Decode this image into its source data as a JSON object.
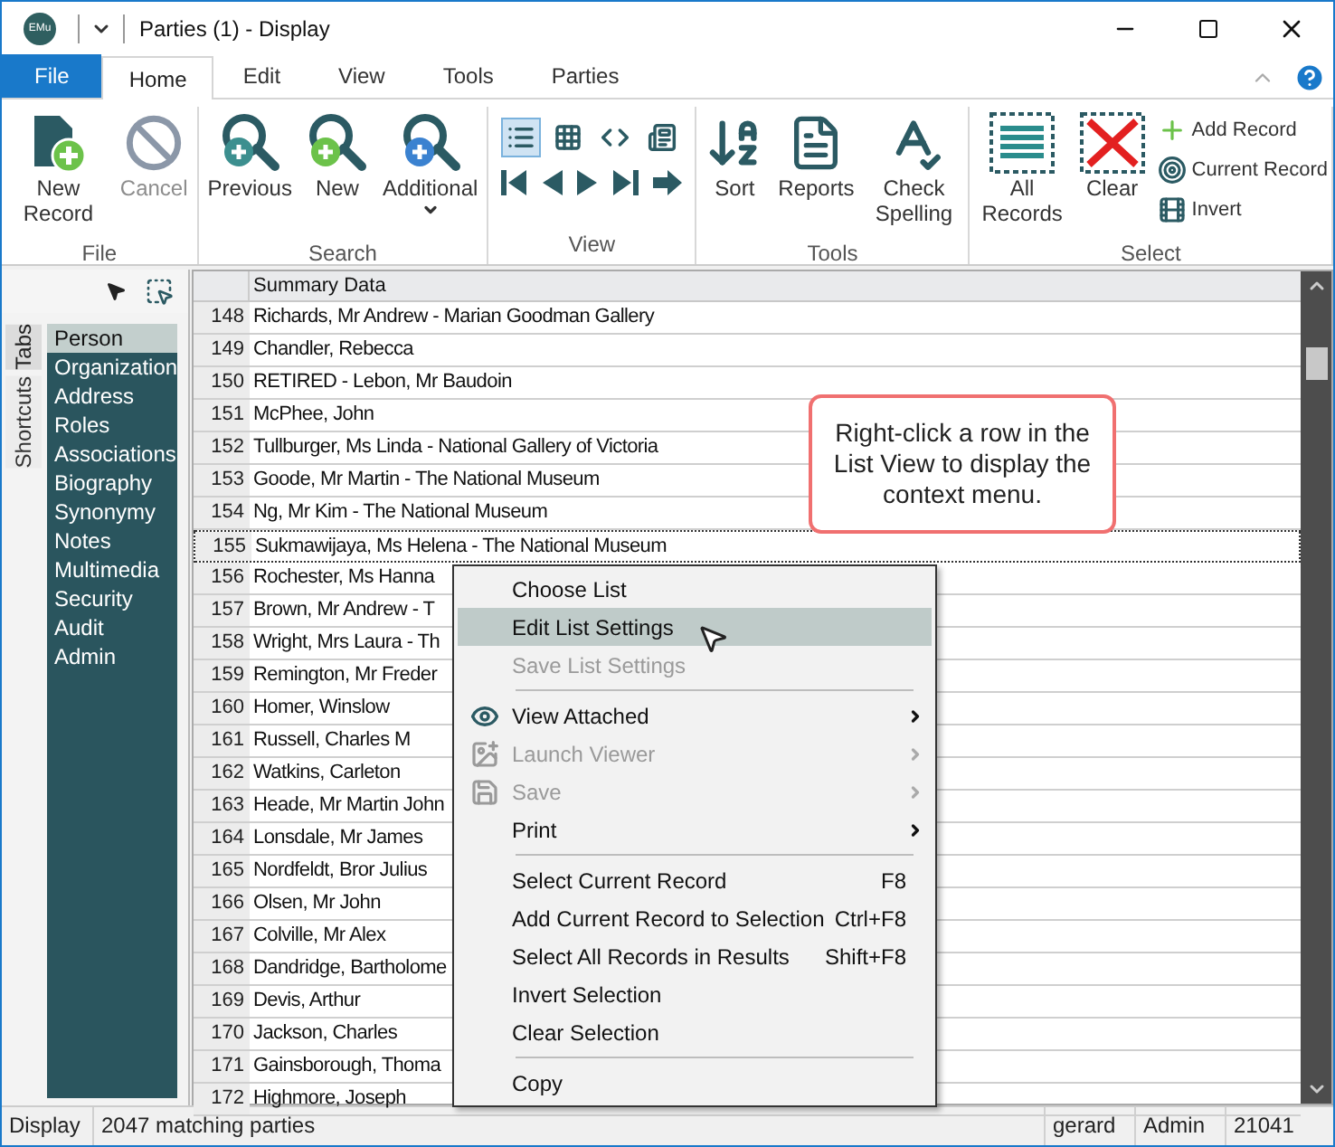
{
  "title_bar": {
    "logo": "EMu",
    "title": "Parties (1) - Display"
  },
  "ribbon_tabs": [
    {
      "label": "File",
      "kind": "file",
      "selected": false
    },
    {
      "label": "Home",
      "kind": "tab",
      "selected": true
    },
    {
      "label": "Edit",
      "kind": "tab",
      "selected": false
    },
    {
      "label": "View",
      "kind": "tab",
      "selected": false
    },
    {
      "label": "Tools",
      "kind": "tab",
      "selected": false
    },
    {
      "label": "Parties",
      "kind": "tab",
      "selected": false
    }
  ],
  "ribbon_groups": [
    {
      "title": "File",
      "kind": "large",
      "buttons": [
        {
          "label": "New Record",
          "disabled": false,
          "dropdown": false
        },
        {
          "label": "Cancel",
          "disabled": true,
          "dropdown": false
        }
      ]
    },
    {
      "title": "Search",
      "kind": "large",
      "buttons": [
        {
          "label": "Previous",
          "disabled": false,
          "dropdown": false
        },
        {
          "label": "New",
          "disabled": false,
          "dropdown": false
        },
        {
          "label": "Additional",
          "disabled": false,
          "dropdown": true
        }
      ]
    },
    {
      "title": "View",
      "kind": "view",
      "view_modes": [
        {
          "selected": true
        },
        {
          "selected": false
        },
        {
          "selected": false
        },
        {
          "selected": false
        }
      ]
    },
    {
      "title": "Tools",
      "kind": "large",
      "buttons": [
        {
          "label": "Sort",
          "disabled": false,
          "dropdown": false
        },
        {
          "label": "Reports",
          "disabled": false,
          "dropdown": false
        },
        {
          "label": "Check Spelling",
          "disabled": false,
          "dropdown": false
        }
      ]
    },
    {
      "title": "Select",
      "kind": "select",
      "buttons": [
        {
          "label": "All Records",
          "disabled": false,
          "dropdown": false
        },
        {
          "label": "Clear",
          "disabled": false,
          "dropdown": false
        }
      ],
      "small_buttons": [
        "Add Record",
        "Current Record",
        "Invert"
      ]
    }
  ],
  "left_panel": {
    "vertical_tabs": [
      {
        "label": "Tabs",
        "selected": true
      },
      {
        "label": "Shortcuts",
        "selected": false
      }
    ],
    "tab_items": [
      {
        "label": "Person",
        "selected": true
      },
      {
        "label": "Organization",
        "selected": false
      },
      {
        "label": "Address",
        "selected": false
      },
      {
        "label": "Roles",
        "selected": false
      },
      {
        "label": "Associations",
        "selected": false
      },
      {
        "label": "Biography",
        "selected": false
      },
      {
        "label": "Synonymy",
        "selected": false
      },
      {
        "label": "Notes",
        "selected": false
      },
      {
        "label": "Multimedia",
        "selected": false
      },
      {
        "label": "Security",
        "selected": false
      },
      {
        "label": "Audit",
        "selected": false
      },
      {
        "label": "Admin",
        "selected": false
      }
    ]
  },
  "list_view": {
    "columns": [
      "Summary Data"
    ],
    "rows": [
      {
        "number": "148",
        "summary": "Richards, Mr Andrew - Marian Goodman Gallery",
        "focused": false
      },
      {
        "number": "149",
        "summary": "Chandler, Rebecca",
        "focused": false
      },
      {
        "number": "150",
        "summary": "RETIRED - Lebon, Mr Baudoin",
        "focused": false
      },
      {
        "number": "151",
        "summary": "McPhee, John",
        "focused": false
      },
      {
        "number": "152",
        "summary": "Tullburger, Ms Linda - National Gallery of Victoria",
        "focused": false
      },
      {
        "number": "153",
        "summary": "Goode, Mr Martin - The National Museum",
        "focused": false
      },
      {
        "number": "154",
        "summary": "Ng, Mr Kim - The National Museum",
        "focused": false
      },
      {
        "number": "155",
        "summary": "Sukmawijaya, Ms Helena - The National Museum",
        "focused": true
      },
      {
        "number": "156",
        "summary": "Rochester, Ms Hanna",
        "focused": false
      },
      {
        "number": "157",
        "summary": "Brown, Mr Andrew - T",
        "focused": false
      },
      {
        "number": "158",
        "summary": "Wright, Mrs Laura - Th",
        "focused": false
      },
      {
        "number": "159",
        "summary": "Remington, Mr Freder",
        "focused": false
      },
      {
        "number": "160",
        "summary": "Homer, Winslow",
        "focused": false
      },
      {
        "number": "161",
        "summary": "Russell, Charles M",
        "focused": false
      },
      {
        "number": "162",
        "summary": "Watkins, Carleton",
        "focused": false
      },
      {
        "number": "163",
        "summary": "Heade, Mr Martin John",
        "focused": false
      },
      {
        "number": "164",
        "summary": "Lonsdale, Mr James",
        "focused": false
      },
      {
        "number": "165",
        "summary": "Nordfeldt, Bror Julius",
        "focused": false
      },
      {
        "number": "166",
        "summary": "Olsen, Mr John",
        "focused": false
      },
      {
        "number": "167",
        "summary": "Colville, Mr Alex",
        "focused": false
      },
      {
        "number": "168",
        "summary": "Dandridge, Bartholome",
        "focused": false
      },
      {
        "number": "169",
        "summary": "Devis, Arthur",
        "focused": false
      },
      {
        "number": "170",
        "summary": "Jackson, Charles",
        "focused": false
      },
      {
        "number": "171",
        "summary": "Gainsborough, Thoma",
        "focused": false
      },
      {
        "number": "172",
        "summary": "Highmore, Joseph",
        "focused": false
      }
    ]
  },
  "callout": {
    "text": "Right-click a row in the List View to display the context menu."
  },
  "context_menu": {
    "items": [
      {
        "kind": "item",
        "label": "Choose List",
        "selected": false,
        "disabled": false,
        "submenu": false
      },
      {
        "kind": "item",
        "label": "Edit List Settings",
        "selected": true,
        "disabled": false,
        "submenu": false
      },
      {
        "kind": "item",
        "label": "Save List Settings",
        "selected": false,
        "disabled": true,
        "submenu": false
      },
      {
        "kind": "separator"
      },
      {
        "kind": "item",
        "label": "View Attached",
        "selected": false,
        "disabled": false,
        "submenu": true
      },
      {
        "kind": "item",
        "label": "Launch Viewer",
        "selected": false,
        "disabled": true,
        "submenu": true
      },
      {
        "kind": "item",
        "label": "Save",
        "selected": false,
        "disabled": true,
        "submenu": true
      },
      {
        "kind": "item",
        "label": "Print",
        "selected": false,
        "disabled": false,
        "submenu": true
      },
      {
        "kind": "separator"
      },
      {
        "kind": "item",
        "label": "Select Current Record",
        "shortcut": "F8",
        "selected": false,
        "disabled": false,
        "submenu": false
      },
      {
        "kind": "item",
        "label": "Add Current Record to Selection",
        "shortcut": "Ctrl+F8",
        "selected": false,
        "disabled": false,
        "submenu": false
      },
      {
        "kind": "item",
        "label": "Select All Records in Results",
        "shortcut": "Shift+F8",
        "selected": false,
        "disabled": false,
        "submenu": false
      },
      {
        "kind": "item",
        "label": "Invert Selection",
        "selected": false,
        "disabled": false,
        "submenu": false
      },
      {
        "kind": "item",
        "label": "Clear Selection",
        "selected": false,
        "disabled": false,
        "submenu": false
      },
      {
        "kind": "separator"
      },
      {
        "kind": "item",
        "label": "Copy",
        "selected": false,
        "disabled": false,
        "submenu": false
      }
    ]
  },
  "status_bar": [
    "Display",
    "2047 matching parties",
    "gerard",
    "Admin",
    "21041"
  ]
}
